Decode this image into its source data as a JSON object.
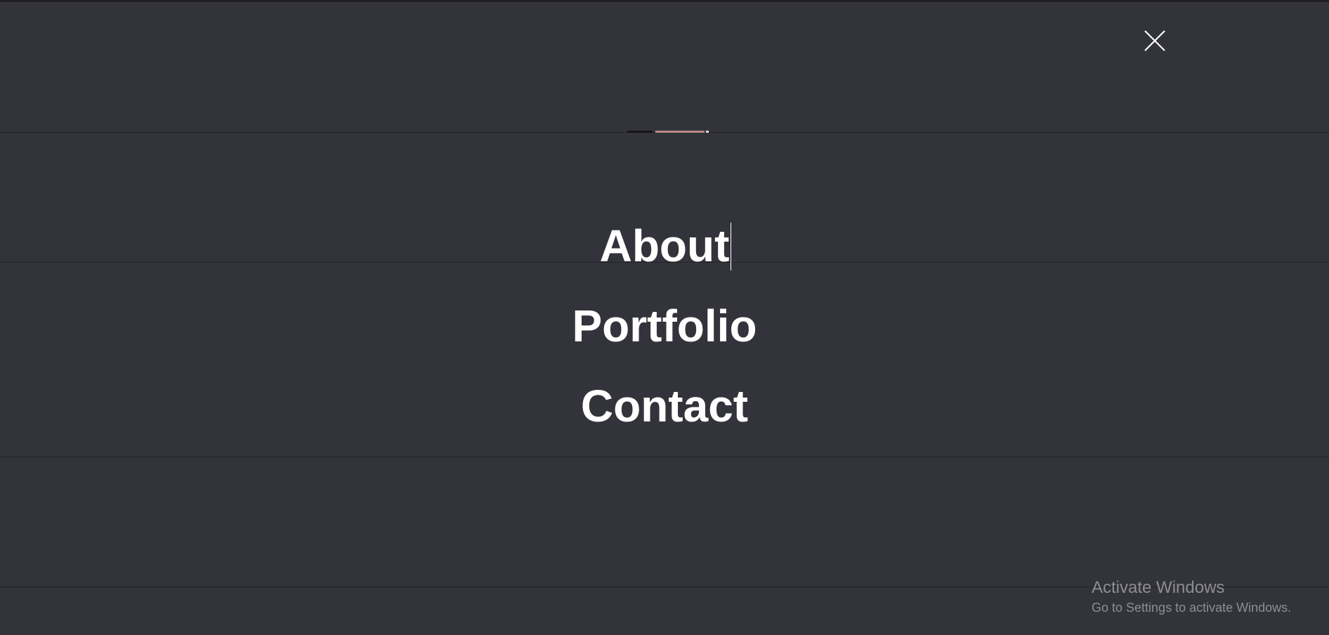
{
  "menu": {
    "items": [
      {
        "label": "About"
      },
      {
        "label": "Portfolio"
      },
      {
        "label": "Contact"
      }
    ],
    "close_icon": "close-icon"
  },
  "watermark": {
    "title": "Activate Windows",
    "subtitle": "Go to Settings to activate Windows."
  },
  "colors": {
    "overlay_background": "#33333b",
    "menu_text": "#ffffff",
    "watermark_text": "#8d8d93"
  }
}
